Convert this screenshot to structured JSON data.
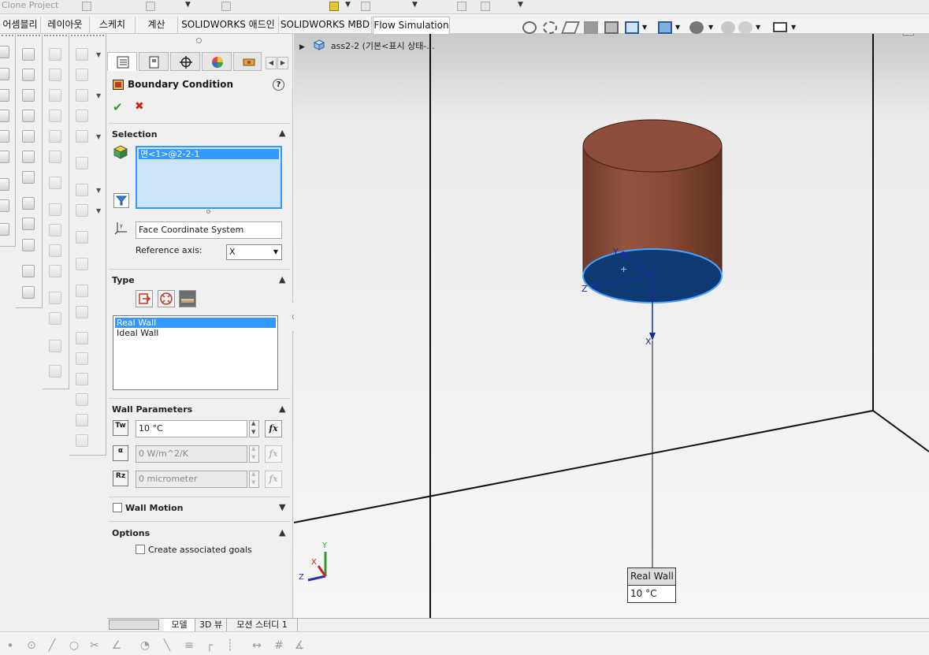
{
  "top": {
    "clone_label": "Clone Project"
  },
  "tabs": [
    {
      "label": "어셈블리"
    },
    {
      "label": "레이아웃"
    },
    {
      "label": "스케치"
    },
    {
      "label": "계산"
    },
    {
      "label": "SOLIDWORKS 애드인"
    },
    {
      "label": "SOLIDWORKS MBD"
    },
    {
      "label": "Flow Simulation",
      "active": true
    }
  ],
  "tree": {
    "item": "ass2-2 (기본<표시 상태-..."
  },
  "panel": {
    "title": "Boundary Condition",
    "help_icon": "help-icon",
    "ok_icon": "checkmark-icon",
    "cancel_icon": "close-icon",
    "selection": {
      "header": "Selection",
      "items": [
        "면<1>@2-2-1"
      ],
      "coordinate_system": "Face Coordinate System",
      "reference_axis_label": "Reference axis:",
      "reference_axis_value": "X"
    },
    "type": {
      "header": "Type",
      "options": [
        "Real Wall",
        "Ideal Wall"
      ],
      "selected": "Real Wall"
    },
    "wall_parameters": {
      "header": "Wall Parameters",
      "temperature": "10 °C",
      "temperature_icon_label": "Tw",
      "heat_transfer": "0 W/m^2/K",
      "heat_transfer_icon_label": "α",
      "roughness": "0 micrometer",
      "roughness_icon_label": "Rz",
      "fx_label": "fx"
    },
    "wall_motion": {
      "label": "Wall Motion"
    },
    "options": {
      "header": "Options",
      "create_goals": "Create associated goals"
    }
  },
  "viewport": {
    "callout_title": "Real Wall",
    "callout_value": "10 °C",
    "triad": {
      "x": "X",
      "y": "Y",
      "z": "Z"
    },
    "colors": {
      "cylinder": "#8a4a36",
      "face": "#0d3a72",
      "face_edge": "#4aa3ff",
      "axis": "#1d2a9a"
    }
  },
  "bottom_tabs": [
    {
      "label": "모델",
      "active": true
    },
    {
      "label": "3D 뷰"
    },
    {
      "label": "모션 스터디 1"
    }
  ]
}
